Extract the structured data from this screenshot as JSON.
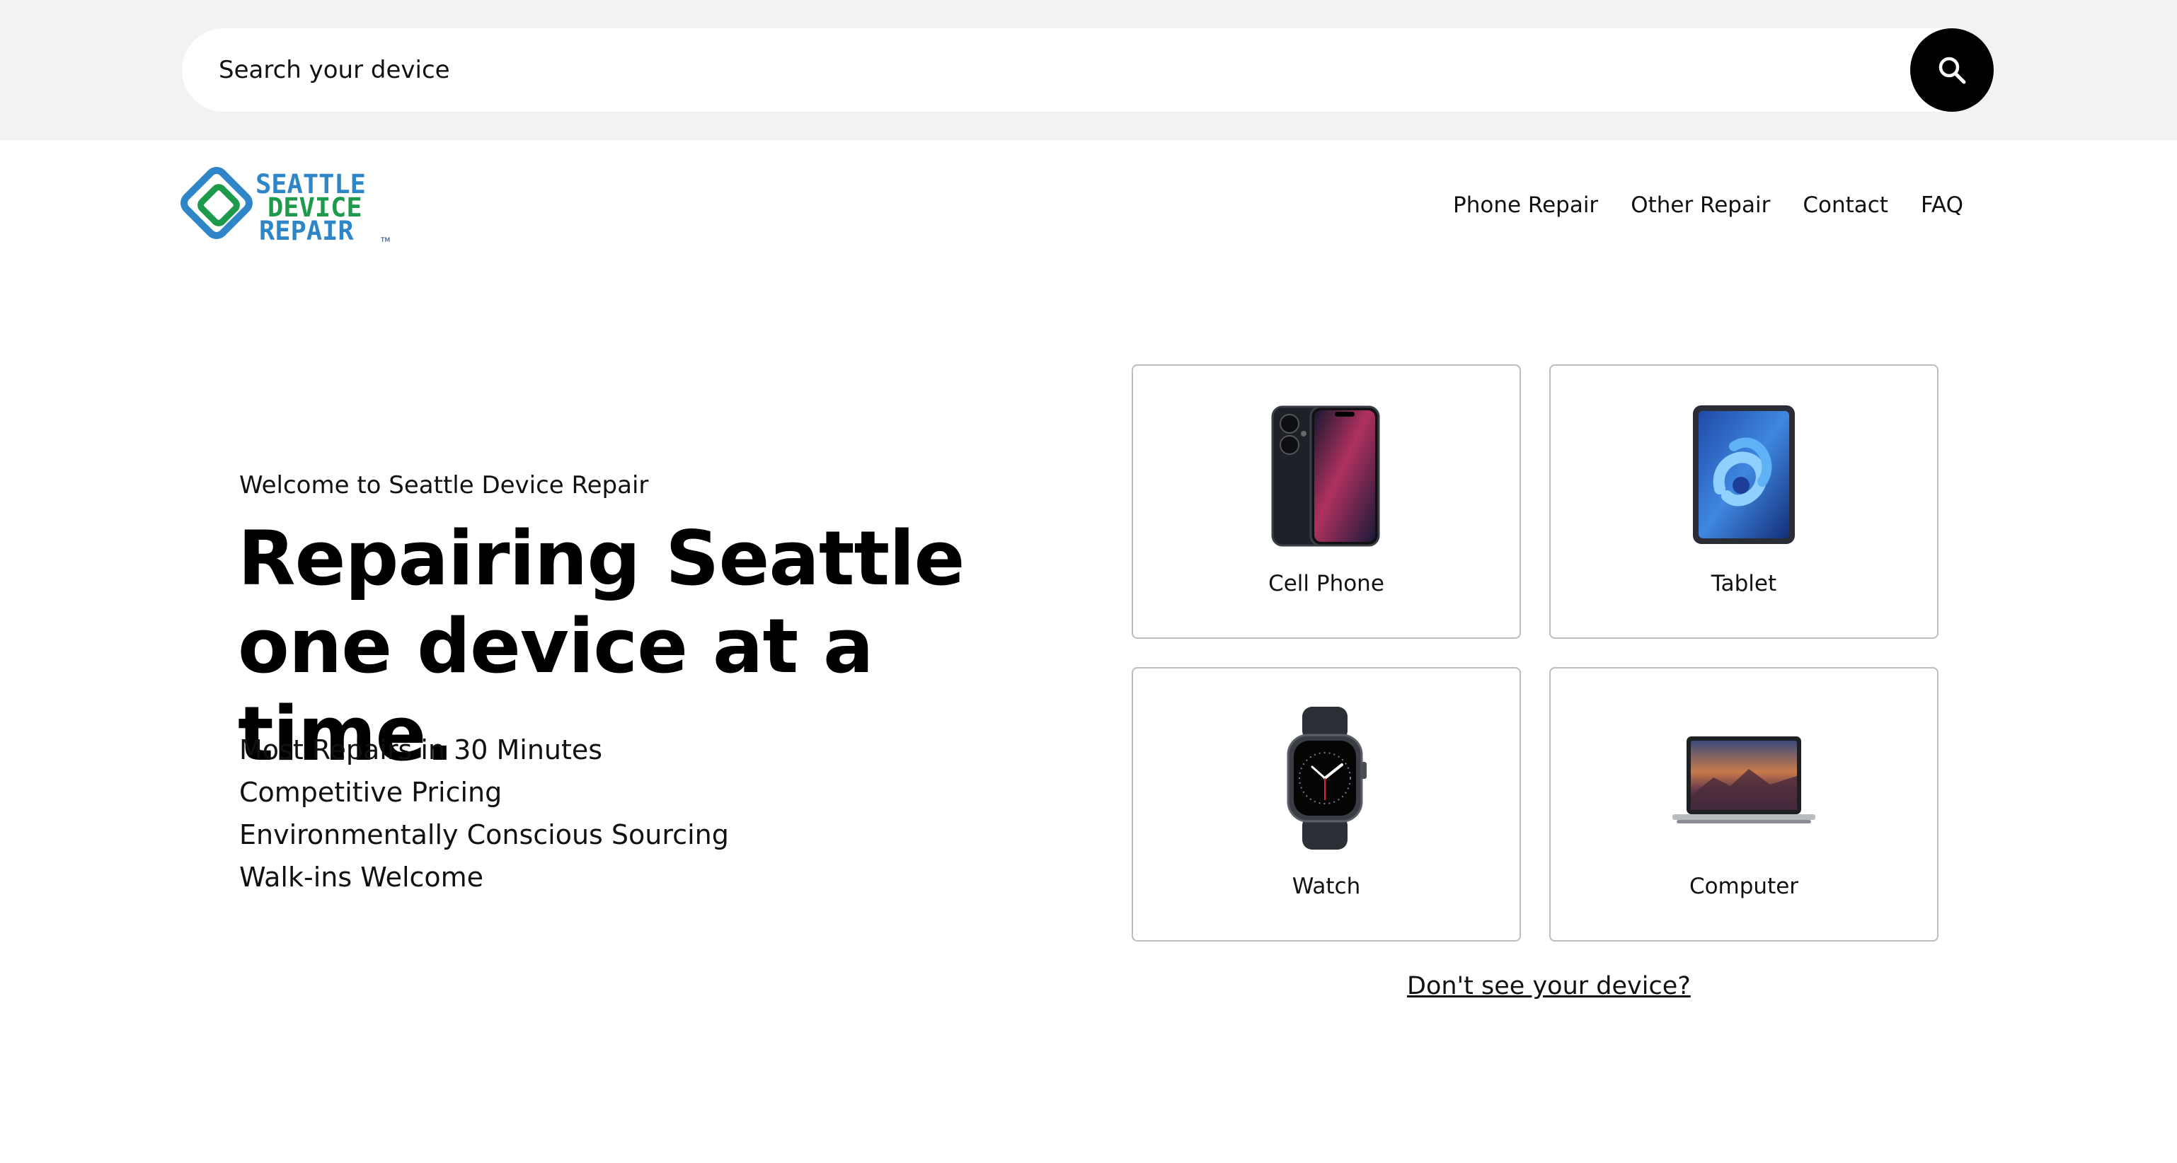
{
  "search": {
    "placeholder": "Search your device",
    "icon": "search-icon"
  },
  "brand": {
    "line1": "SEATTLE",
    "line2": "DEVICE",
    "line3": "REPAIR",
    "tm": "TM",
    "colors": {
      "blue": "#2e86c9",
      "green": "#1e9a4c",
      "dark": "#1a3a6b"
    }
  },
  "nav": {
    "items": [
      {
        "label": "Phone Repair"
      },
      {
        "label": "Other Repair"
      },
      {
        "label": "Contact"
      },
      {
        "label": "FAQ"
      }
    ]
  },
  "hero": {
    "welcome": "Welcome to Seattle Device Repair",
    "headline": "Repairing Seattle one device at a time.",
    "features": [
      "Most Repairs in 30 Minutes",
      "Competitive Pricing",
      "Environmentally Conscious Sourcing",
      "Walk-ins Welcome"
    ]
  },
  "devices": [
    {
      "label": "Cell Phone",
      "icon": "phone-icon"
    },
    {
      "label": "Tablet",
      "icon": "tablet-icon"
    },
    {
      "label": "Watch",
      "icon": "watch-icon"
    },
    {
      "label": "Computer",
      "icon": "laptop-icon"
    }
  ],
  "dont_see": "Don't see your device?"
}
